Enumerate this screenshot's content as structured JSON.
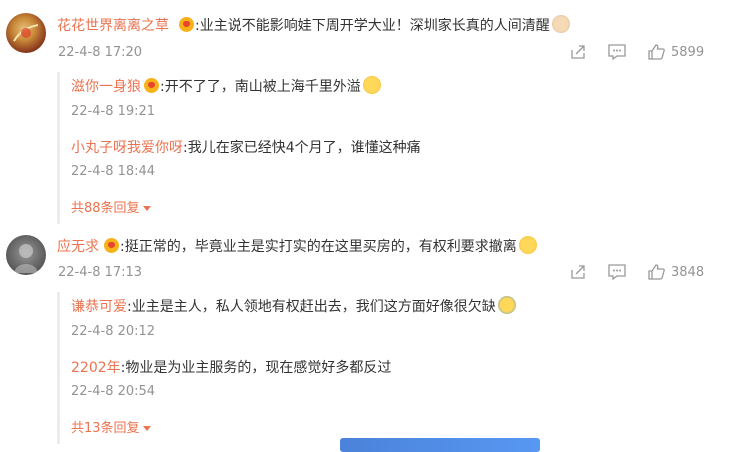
{
  "comments": [
    {
      "username": "花花世界离离之草",
      "text": ":业主说不能影响娃下周开学大业！深圳家长真的人间清醒",
      "time": "22-4-8 17:20",
      "likes": "5899",
      "replies": [
        {
          "username": "滋你一身狼",
          "text": ":开不了了，南山被上海千里外溢",
          "time": "22-4-8 19:21"
        },
        {
          "username": "小丸子呀我爱你呀",
          "text": ":我儿在家已经快4个月了，谁懂这种痛",
          "time": "22-4-8 18:44"
        }
      ],
      "more_replies": "共88条回复"
    },
    {
      "username": "应无求",
      "text": ":挺正常的，毕竟业主是实打实的在这里买房的，有权利要求撤离",
      "time": "22-4-8 17:13",
      "likes": "3848",
      "replies": [
        {
          "username": "谦恭可爱",
          "text": ":业主是主人，私人领地有权赶出去，我们这方面好像很欠缺",
          "time": "22-4-8 20:12"
        },
        {
          "username": "2202年",
          "text": ":物业是为业主服务的，现在感觉好多都反过",
          "time": "22-4-8 20:54"
        }
      ],
      "more_replies": "共13条回复"
    }
  ],
  "icons": {
    "share": "share-icon",
    "comment": "comment-icon",
    "like": "like-icon",
    "vip_badge": "vip-badge-icon"
  },
  "colors": {
    "username": "#eb7350",
    "meta": "#939393",
    "text": "#333333"
  }
}
